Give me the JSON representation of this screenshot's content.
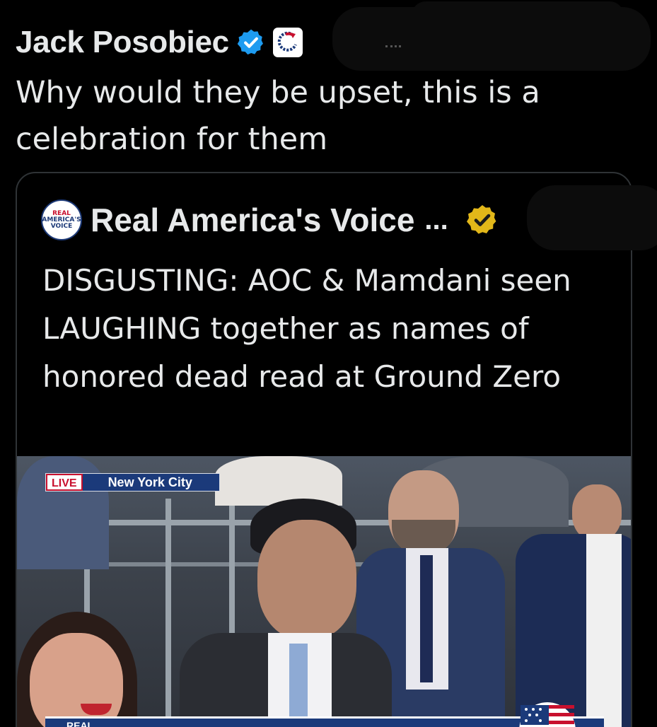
{
  "tweet": {
    "author_name": "Jack Posobiec",
    "text": "Why would they be upset, this is a celebration for them"
  },
  "quote": {
    "author_name": "Real America's Voice",
    "ellipsis": "...",
    "avatar_line1": "REAL",
    "avatar_line2": "AMERICA'S",
    "avatar_line3": "VOICE",
    "text": "DISGUSTING: AOC & Mamdani seen LAUGHING together as names of honored dead read at Ground Zero"
  },
  "video": {
    "live_label": "LIVE",
    "location_label": "New York City",
    "lower_third_logo": "REAL"
  },
  "colors": {
    "verified_blue": "#1d9bf0",
    "gold_badge": "#e2b719",
    "brand_navy": "#1b3a7a",
    "live_red": "#c8102e"
  }
}
